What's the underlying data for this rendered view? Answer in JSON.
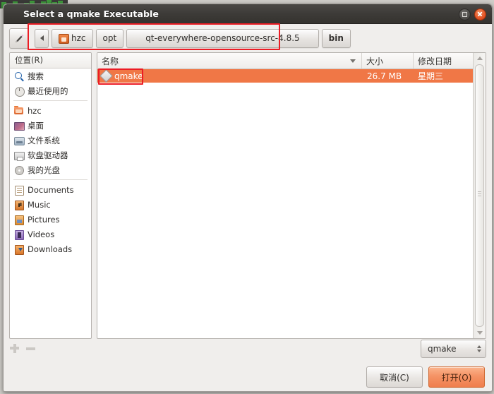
{
  "window": {
    "title": "Select a qmake Executable",
    "buttons": {
      "maximize": "maximize-button",
      "close": "close-button"
    }
  },
  "toolbar": {
    "location_toggle_icon": "pencil-icon",
    "back_label": "◂"
  },
  "pathbar": {
    "crumbs": [
      {
        "label": "hzc",
        "icon": "home-folder-icon",
        "selected": false
      },
      {
        "label": "opt",
        "icon": "",
        "selected": false
      },
      {
        "label": "qt-everywhere-opensource-src-4.8.5",
        "icon": "",
        "selected": false
      },
      {
        "label": "bin",
        "icon": "",
        "selected": true
      }
    ]
  },
  "sidebar": {
    "header": "位置(R)",
    "groups": [
      [
        {
          "label": "搜索",
          "icon": "search-icon"
        },
        {
          "label": "最近使用的",
          "icon": "recent-icon"
        }
      ],
      [
        {
          "label": "hzc",
          "icon": "home-folder-icon"
        },
        {
          "label": "桌面",
          "icon": "desktop-icon"
        },
        {
          "label": "文件系统",
          "icon": "filesystem-icon"
        },
        {
          "label": "软盘驱动器",
          "icon": "floppy-icon"
        },
        {
          "label": "我的光盘",
          "icon": "cdrom-icon"
        }
      ],
      [
        {
          "label": "Documents",
          "icon": "documents-icon"
        },
        {
          "label": "Music",
          "icon": "music-icon"
        },
        {
          "label": "Pictures",
          "icon": "pictures-icon"
        },
        {
          "label": "Videos",
          "icon": "videos-icon"
        },
        {
          "label": "Downloads",
          "icon": "downloads-icon"
        }
      ]
    ],
    "add_button": "+",
    "remove_button": "−"
  },
  "filelist": {
    "columns": [
      {
        "key": "name",
        "label": "名称",
        "sorted": true
      },
      {
        "key": "size",
        "label": "大小",
        "sorted": false
      },
      {
        "key": "date",
        "label": "修改日期",
        "sorted": false
      }
    ],
    "rows": [
      {
        "name": "qmake",
        "size": "26.7 MB",
        "date": "星期三",
        "icon": "qt-executable-icon",
        "selected": true
      }
    ]
  },
  "filter": {
    "value": "qmake"
  },
  "actions": {
    "cancel": "取消(C)",
    "open": "打开(O)"
  },
  "colors": {
    "selection": "#f07746",
    "primary_button": "#ef7e4d",
    "annotation": "#ec1c24",
    "titlebar": "#3c3a37"
  }
}
